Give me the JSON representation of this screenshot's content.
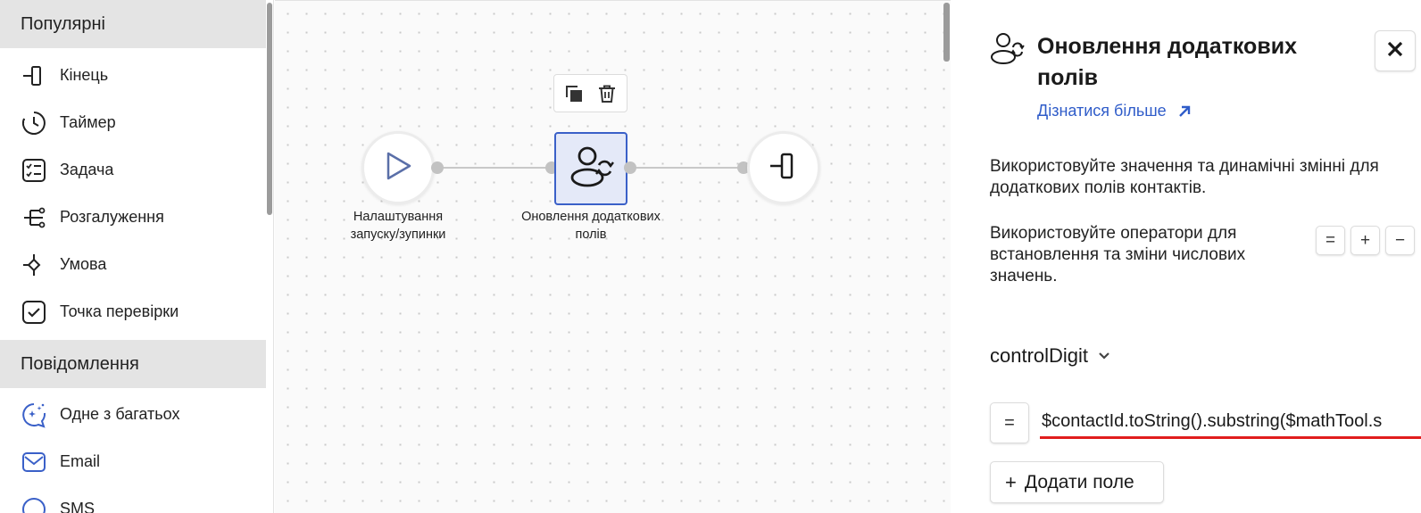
{
  "sidebar": {
    "sections": [
      {
        "title": "Популярні"
      },
      {
        "title": "Повідомлення"
      }
    ],
    "popular_items": [
      {
        "label": "Кінець",
        "icon": "end-icon"
      },
      {
        "label": "Таймер",
        "icon": "timer-icon"
      },
      {
        "label": "Задача",
        "icon": "task-icon"
      },
      {
        "label": "Розгалуження",
        "icon": "branch-icon"
      },
      {
        "label": "Умова",
        "icon": "condition-icon"
      },
      {
        "label": "Точка перевірки",
        "icon": "checkpoint-icon"
      }
    ],
    "message_items": [
      {
        "label": "Одне з багатьох",
        "icon": "one-of-many-icon"
      },
      {
        "label": "Email",
        "icon": "email-icon"
      },
      {
        "label": "SMS",
        "icon": "sms-icon"
      }
    ]
  },
  "canvas": {
    "nodes": [
      {
        "label_line1": "Налаштування",
        "label_line2": "запуску/зупинки",
        "icon": "play-icon"
      },
      {
        "label_line1": "Оновлення додаткових",
        "label_line2": "полів",
        "icon": "user-sync-icon",
        "selected": true
      },
      {
        "label_line1": "",
        "label_line2": "",
        "icon": "end-icon"
      }
    ],
    "toolbar": {
      "copy_icon": "copy-icon",
      "delete_icon": "trash-icon"
    }
  },
  "panel": {
    "title": "Оновлення додаткових полів",
    "learn_more": "Дізнатися більше",
    "description1": "Використовуйте значення та динамічні змінні для додаткових полів контактів.",
    "description2": "Використовуйте оператори для встановлення та зміни числових значень.",
    "operators": [
      "=",
      "+",
      "−"
    ],
    "field_name": "controlDigit",
    "field_operator": "=",
    "field_expression": "$contactId.toString().substring($mathTool.s",
    "add_field_label": "Додати поле"
  },
  "colors": {
    "accent": "#2f5cc9",
    "selected_node_bg": "#e4e9f8",
    "selected_node_border": "#3a60c8",
    "error_underline": "#e11d1d",
    "section_bg": "#e4e4e4"
  }
}
